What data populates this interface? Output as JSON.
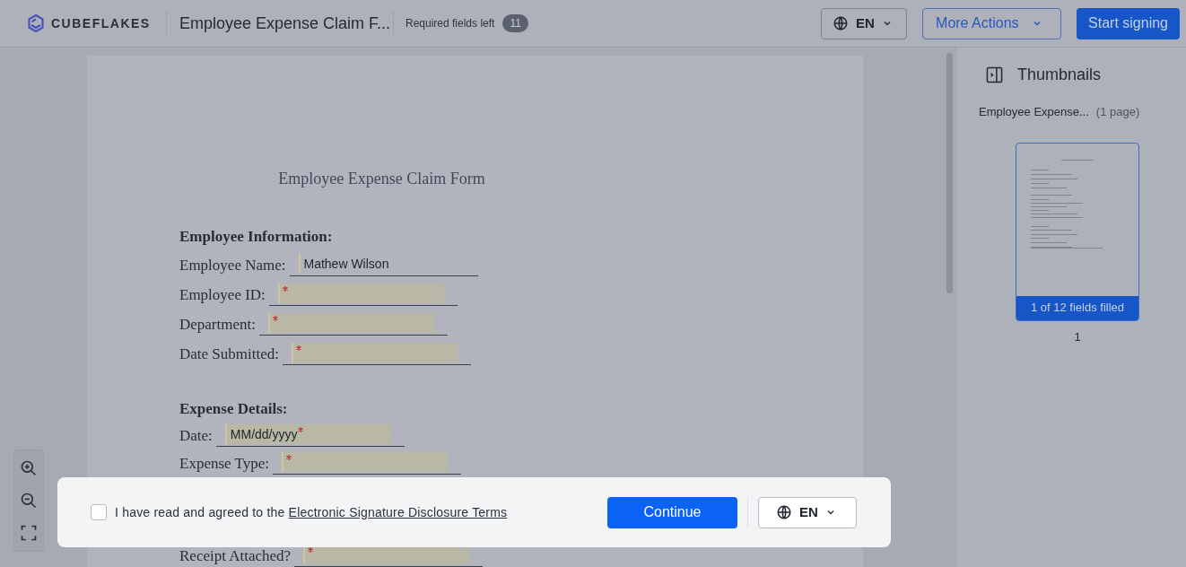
{
  "header": {
    "brand": "CUBEFLAKES",
    "document_title": "Employee Expense Claim F...",
    "required_label": "Required fields left",
    "required_count": "11",
    "language": "EN",
    "more_actions": "More Actions",
    "start_button": "Start signing"
  },
  "document": {
    "title": "Employee Expense Claim Form",
    "sections": [
      {
        "heading": "Employee Information:",
        "fields": [
          {
            "label": "Employee Name:",
            "value": "Mathew Wilson",
            "required": false
          },
          {
            "label": "Employee ID:",
            "required": true
          },
          {
            "label": "Department:",
            "required": true
          },
          {
            "label": "Date Submitted:",
            "required": true
          }
        ]
      },
      {
        "heading": "Expense Details:",
        "fields": [
          {
            "label": "Date:",
            "placeholder": "MM/dd/yyyy",
            "required": true
          },
          {
            "label": "Expense Type:",
            "required": true
          }
        ]
      }
    ],
    "fields_below_dialog": [
      {
        "label": "Receipt Attached?",
        "required": true
      }
    ]
  },
  "thumbnails": {
    "title": "Thumbnails",
    "document_name": "Employee Expense...",
    "page_count": "(1 page)",
    "pages": [
      {
        "status": "1 of 12 fields filled",
        "number": "1",
        "selected": true
      }
    ]
  },
  "consent": {
    "checked": false,
    "text": "I have read and agreed to the ",
    "link": "Electronic Signature Disclosure Terms",
    "continue": "Continue",
    "language": "EN"
  }
}
